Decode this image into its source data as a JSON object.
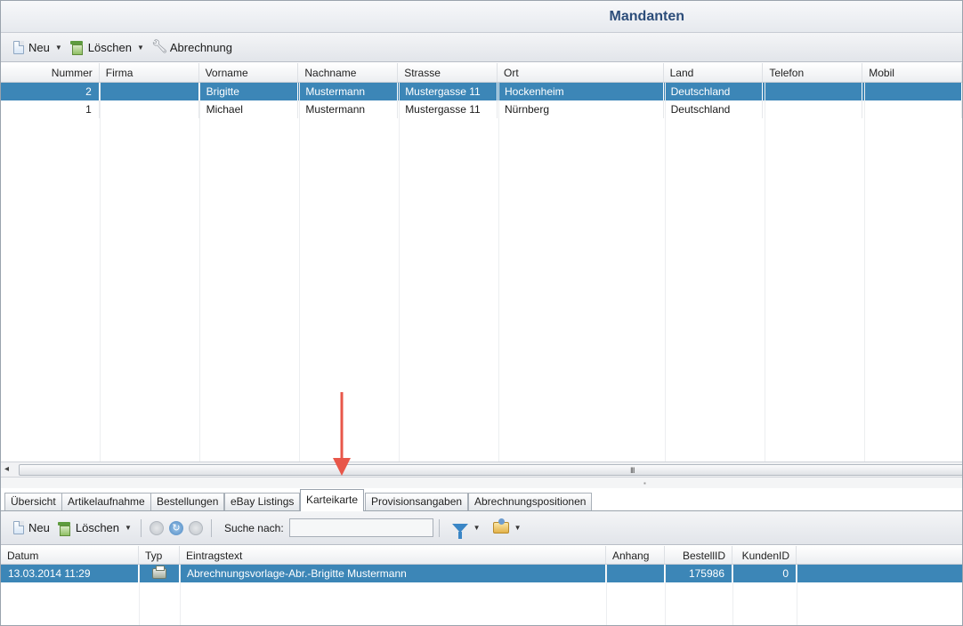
{
  "window": {
    "title": "Mandanten"
  },
  "toolbar_top": {
    "new_label": "Neu",
    "delete_label": "Löschen",
    "billing_label": "Abrechnung"
  },
  "main_grid": {
    "columns": [
      "Nummer",
      "Firma",
      "Vorname",
      "Nachname",
      "Strasse",
      "Ort",
      "Land",
      "Telefon",
      "Mobil"
    ],
    "rows": [
      {
        "nummer": "2",
        "firma": "",
        "vorname": "Brigitte",
        "nachname": "Mustermann",
        "strasse": "Mustergasse 11",
        "ort": "Hockenheim",
        "land": "Deutschland",
        "telefon": "",
        "mobil": "",
        "selected": true
      },
      {
        "nummer": "1",
        "firma": "",
        "vorname": "Michael",
        "nachname": "Mustermann",
        "strasse": "Mustergasse 11",
        "ort": "Nürnberg",
        "land": "Deutschland",
        "telefon": "",
        "mobil": "",
        "selected": false
      }
    ]
  },
  "scrollbar": {
    "left_arrow": "◂",
    "grip": "III"
  },
  "tabs": [
    {
      "label": "Übersicht"
    },
    {
      "label": "Artikelaufnahme"
    },
    {
      "label": "Bestellungen"
    },
    {
      "label": "eBay Listings"
    },
    {
      "label": "Karteikarte",
      "active": true
    },
    {
      "label": "Provisionsangaben"
    },
    {
      "label": "Abrechnungspositionen"
    }
  ],
  "toolbar_bottom": {
    "new_label": "Neu",
    "delete_label": "Löschen",
    "search_label": "Suche nach:",
    "search_value": ""
  },
  "entries_grid": {
    "columns": [
      "Datum",
      "Typ",
      "Eintragstext",
      "Anhang",
      "BestellID",
      "KundenID"
    ],
    "rows": [
      {
        "datum": "13.03.2014 11:29",
        "typ": "printer-icon",
        "eintragstext": "Abrechnungsvorlage-Abr.-Brigitte Mustermann",
        "anhang": "",
        "bestellid": "175986",
        "kundenid": "0",
        "selected": true
      }
    ]
  },
  "colors": {
    "selection": "#3c86b7",
    "title": "#2c4d7a",
    "annotation_arrow": "#e8574a"
  }
}
